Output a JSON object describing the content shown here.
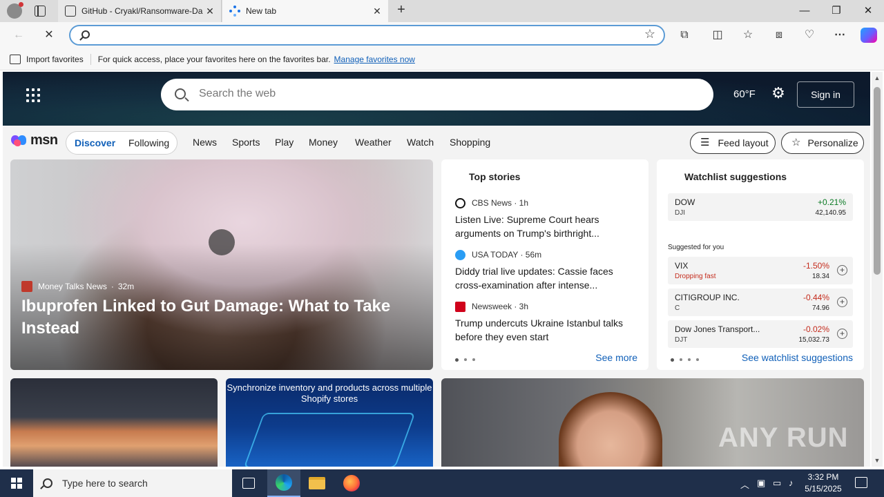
{
  "browser": {
    "tabs": [
      {
        "title": "GitHub - Cryakl/Ransomware-Da",
        "close": "✕"
      },
      {
        "title": "New tab",
        "close": "✕"
      }
    ],
    "new_tab": "+",
    "window_controls": {
      "minimize": "—",
      "restore": "❐",
      "close": "✕"
    },
    "address": {
      "value": "",
      "placeholder": ""
    },
    "nav": {
      "back": "←",
      "stop": "✕"
    },
    "toolbar_icons": [
      "extensions-icon",
      "split-screen-icon",
      "favorites-icon",
      "collections-icon",
      "performance-icon",
      "more-icon",
      "copilot-icon"
    ]
  },
  "favorites_bar": {
    "import_label": "Import favorites",
    "hint": "For quick access, place your favorites here on the favorites bar.",
    "manage_link": "Manage favorites now"
  },
  "msn": {
    "search_placeholder": "Search the web",
    "temperature": "60°F",
    "sign_in": "Sign in",
    "logo_text": "msn",
    "segments": [
      {
        "label": "Discover",
        "active": true
      },
      {
        "label": "Following",
        "active": false
      }
    ],
    "nav_links": [
      "News",
      "Sports",
      "Play",
      "Money",
      "Weather",
      "Watch",
      "Shopping"
    ],
    "feed_layout": "Feed layout",
    "personalize": "Personalize"
  },
  "hero": {
    "source": "Money Talks News",
    "age": "32m",
    "title": "Ibuprofen Linked to Gut Damage: What to Take Instead"
  },
  "top_stories": {
    "title": "Top stories",
    "items": [
      {
        "source": "CBS News · 1h",
        "title": "Listen Live: Supreme Court hears arguments on Trump's birthright..."
      },
      {
        "source": "USA TODAY · 56m",
        "title": "Diddy trial live updates: Cassie faces cross-examination after intense..."
      },
      {
        "source": "Newsweek · 3h",
        "title": "Trump undercuts Ukraine Istanbul talks before they even start"
      }
    ],
    "see_more": "See more"
  },
  "watchlist": {
    "title": "Watchlist suggestions",
    "primary": {
      "name": "DOW",
      "symbol": "DJI",
      "change": "+0.21%",
      "price": "42,140.95"
    },
    "suggested_label": "Suggested for you",
    "suggested": [
      {
        "name": "VIX",
        "note": "Dropping fast",
        "change": "-1.50%",
        "price": "18.34"
      },
      {
        "name": "CITIGROUP INC.",
        "symbol": "C",
        "change": "-0.44%",
        "price": "74.96"
      },
      {
        "name": "Dow Jones Transport...",
        "symbol": "DJT",
        "change": "-0.02%",
        "price": "15,032.73"
      }
    ],
    "add": "+",
    "see_link": "See watchlist suggestions"
  },
  "ad": {
    "text": "Synchronize inventory and products across multiple Shopify stores"
  },
  "watermark": "ANY RUN",
  "taskbar": {
    "search_placeholder": "Type here to search",
    "time": "3:32 PM",
    "date": "5/15/2025"
  }
}
